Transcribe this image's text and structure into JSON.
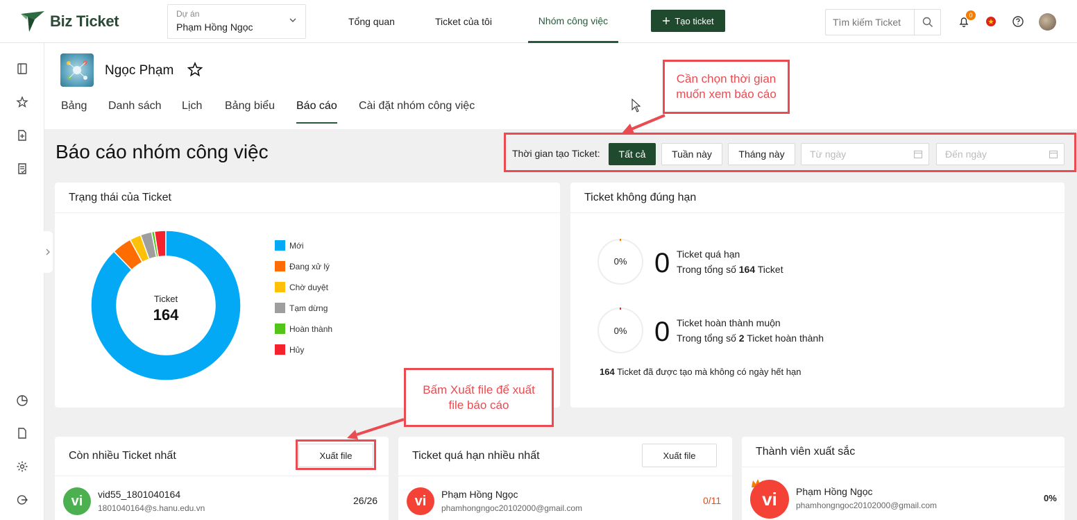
{
  "header": {
    "logo_text": "Biz Ticket",
    "project_label": "Dự án",
    "project_value": "Phạm Hồng Ngọc",
    "nav": [
      {
        "label": "Tổng quan"
      },
      {
        "label": "Ticket của tôi"
      },
      {
        "label": "Nhóm công việc",
        "active": true
      }
    ],
    "create_label": "Tạo ticket",
    "search_placeholder": "Tìm kiếm Ticket",
    "notification_count": "0"
  },
  "project": {
    "name": "Ngọc Phạm",
    "tabs": [
      {
        "label": "Bảng"
      },
      {
        "label": "Danh sách"
      },
      {
        "label": "Lịch"
      },
      {
        "label": "Bảng biểu"
      },
      {
        "label": "Báo cáo",
        "active": true
      },
      {
        "label": "Cài đặt nhóm công việc"
      }
    ]
  },
  "page": {
    "title": "Báo cáo nhóm công việc",
    "filter_label": "Thời gian tạo Ticket:",
    "filter_buttons": [
      "Tất cả",
      "Tuần này",
      "Tháng này"
    ],
    "from_placeholder": "Từ ngày",
    "to_placeholder": "Đến ngày"
  },
  "status_card": {
    "title": "Trạng thái của Ticket",
    "center_label": "Ticket",
    "total": "164",
    "legend": [
      {
        "label": "Mới",
        "color": "#03a9f4"
      },
      {
        "label": "Đang xử lý",
        "color": "#ff6d00"
      },
      {
        "label": "Chờ duyệt",
        "color": "#ffc107"
      },
      {
        "label": "Tạm dừng",
        "color": "#9e9e9e"
      },
      {
        "label": "Hoàn thành",
        "color": "#52c41a"
      },
      {
        "label": "Hủy",
        "color": "#f5222d"
      }
    ]
  },
  "chart_data": {
    "type": "pie",
    "categories": [
      "Mới",
      "Đang xử lý",
      "Chờ duyệt",
      "Tạm dừng",
      "Hoàn thành",
      "Hủy"
    ],
    "values": [
      144,
      7,
      4,
      4,
      1,
      4
    ],
    "colors": [
      "#03a9f4",
      "#ff6d00",
      "#ffc107",
      "#9e9e9e",
      "#52c41a",
      "#f5222d"
    ],
    "title": "Trạng thái của Ticket",
    "legend_position": "right"
  },
  "deadline_card": {
    "title": "Ticket không đúng hạn",
    "overdue": {
      "percent": "0%",
      "count": "0",
      "label": "Ticket quá hạn",
      "prefix": "Trong tổng số",
      "total": "164",
      "suffix": "Ticket"
    },
    "late": {
      "percent": "0%",
      "count": "0",
      "label": "Ticket hoàn thành muộn",
      "prefix": "Trong tổng số",
      "total": "2",
      "suffix": "Ticket hoàn thành"
    },
    "footer_count": "164",
    "footer_text": "Ticket đã được tạo mà không có ngày hết hạn"
  },
  "most_tickets": {
    "title": "Còn nhiều Ticket nhất",
    "export_label": "Xuất file",
    "rows": [
      {
        "initials": "vi",
        "name": "vid55_1801040164",
        "email": "1801040164@s.hanu.edu.vn",
        "value": "26/26",
        "color": "#4caf50"
      }
    ]
  },
  "most_overdue": {
    "title": "Ticket quá hạn nhiều nhất",
    "export_label": "Xuất file",
    "rows": [
      {
        "initials": "vi",
        "name": "Phạm Hồng Ngọc",
        "email": "phamhongngoc20102000@gmail.com",
        "value": "0/11",
        "color": "#f44336"
      }
    ]
  },
  "top_members": {
    "title": "Thành viên xuất sắc",
    "rows": [
      {
        "initials": "vi",
        "name": "Phạm Hồng Ngọc",
        "email": "phamhongngoc20102000@gmail.com",
        "value": "0%",
        "color": "#f44336"
      }
    ]
  },
  "annotations": {
    "time_note": "Cần chọn thời gian muốn xem báo cáo",
    "export_note": "Bấm Xuất file để xuất file báo cáo",
    "accent": "#e94b50"
  }
}
